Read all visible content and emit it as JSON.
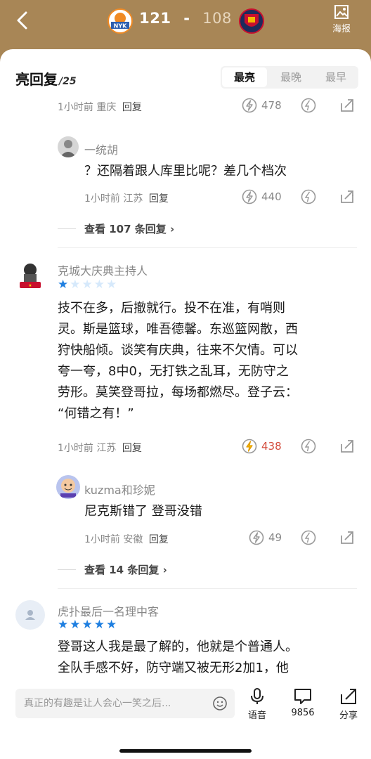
{
  "header": {
    "home_score": "121",
    "separator": "-",
    "away_score": "108",
    "home_team_logo": "NYK",
    "poster_label": "海报",
    "colors": {
      "brand_gold": "#a88656",
      "hot_red": "#d34a3a"
    }
  },
  "section": {
    "title": "亮回复",
    "count": "/25",
    "sort_tabs": [
      "最亮",
      "最晚",
      "最早"
    ]
  },
  "comments": [
    {
      "meta_time": "1小时前",
      "meta_loc": "重庆",
      "reply_label": "回复",
      "likes": "478"
    },
    {
      "user": "一统胡",
      "text": "？还隔着跟人库里比呢？差几个档次",
      "meta_time": "1小时前",
      "meta_loc": "江苏",
      "reply_label": "回复",
      "likes": "440"
    },
    {
      "view_more": "查看 107 条回复"
    },
    {
      "user": "克城大庆典主持人",
      "rating": 1,
      "text_lines": [
        "技不在多，后撤就行。投不在准，有哨则",
        "灵。斯是篮球，唯吾德馨。东巡篮网散，西",
        "狩快船倾。谈笑有庆典，往来不欠情。可以",
        "夸一夸，8中0，无打铁之乱耳，无防守之",
        "劳形。莫笑登哥拉，每场都燃尽。登子云：",
        "“何错之有！”"
      ],
      "meta_time": "1小时前",
      "meta_loc": "江苏",
      "reply_label": "回复",
      "likes": "438"
    },
    {
      "user": "kuzma和珍妮",
      "text": "尼克斯错了 登哥没错",
      "meta_time": "1小时前",
      "meta_loc": "安徽",
      "reply_label": "回复",
      "likes": "49"
    },
    {
      "view_more": "查看 14 条回复"
    },
    {
      "user": "虎扑最后一名理中客",
      "rating": 5,
      "text_lines": [
        "登哥这人我是最了解的，他就是个普通人。",
        "全队手感不好，防守端又被无形2加1，他"
      ]
    }
  ],
  "bottom_bar": {
    "input_placeholder": "真正的有趣是让人会心一笑之后...",
    "voice_label": "语音",
    "comment_count": "9856",
    "share_label": "分享"
  }
}
